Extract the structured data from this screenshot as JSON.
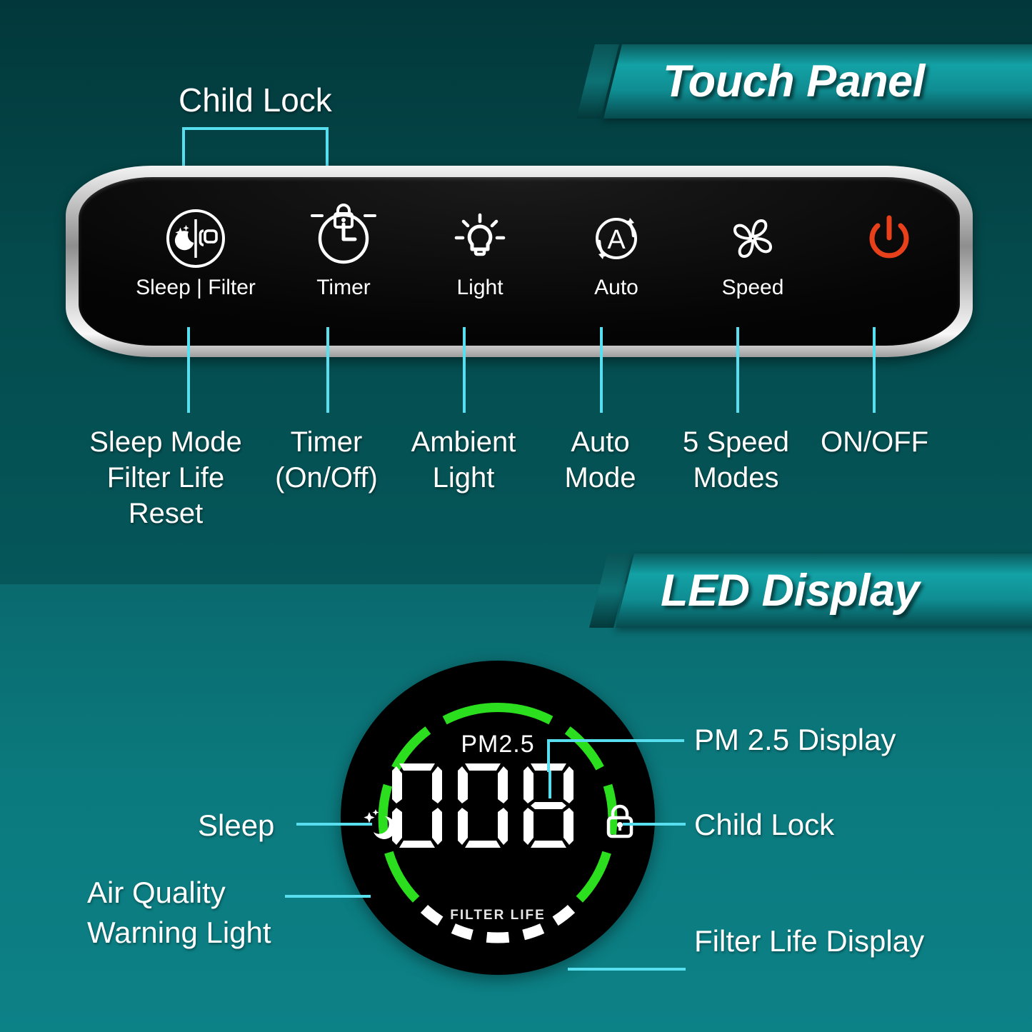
{
  "banners": {
    "touch_panel": "Touch Panel",
    "led_display": "LED Display"
  },
  "touch_panel": {
    "child_lock_title": "Child Lock",
    "lock_indicator_icon": "padlock-icon",
    "buttons": [
      {
        "label": "Sleep | Filter",
        "icon": "sleep-filter-icon",
        "caption": "Sleep Mode\nFilter Life\nReset"
      },
      {
        "label": "Timer",
        "icon": "clock-icon",
        "caption": "Timer\n(On/Off)"
      },
      {
        "label": "Light",
        "icon": "lightbulb-icon",
        "caption": "Ambient\nLight"
      },
      {
        "label": "Auto",
        "icon": "auto-a-icon",
        "caption": "Auto\nMode"
      },
      {
        "label": "Speed",
        "icon": "fan-icon",
        "caption": "5 Speed\nModes"
      },
      {
        "label": "",
        "icon": "power-icon",
        "caption": "ON/OFF"
      }
    ],
    "captions": {
      "sleep_l1": "Sleep Mode",
      "sleep_l2": "Filter Life",
      "sleep_l3": "Reset",
      "timer_l1": "Timer",
      "timer_l2": "(On/Off)",
      "light_l1": "Ambient",
      "light_l2": "Light",
      "auto_l1": "Auto",
      "auto_l2": "Mode",
      "speed_l1": "5 Speed",
      "speed_l2": "Modes",
      "power_l1": "ON/OFF"
    }
  },
  "led_display": {
    "pm_label": "PM2.5",
    "pm_value": "008",
    "filter_life_label": "FILTER LIFE",
    "sleep_icon": "moon-sparkle-icon",
    "lock_icon": "padlock-icon",
    "filter_segments_total": 5,
    "filter_segments_lit": 5,
    "callouts": {
      "sleep": "Sleep",
      "air_quality_l1": "Air Quality",
      "air_quality_l2": "Warning Light",
      "pm25": "PM 2.5 Display",
      "child_lock": "Child Lock",
      "filter_life": "Filter Life Display"
    }
  },
  "colors": {
    "bg_dark_teal": "#034345",
    "bg_light_teal": "#0c8186",
    "callout_cyan": "#57dff0",
    "ring_green": "#2bde1e",
    "power_red": "#e8401a",
    "panel_black": "#000000",
    "text_white": "#ffffff"
  }
}
